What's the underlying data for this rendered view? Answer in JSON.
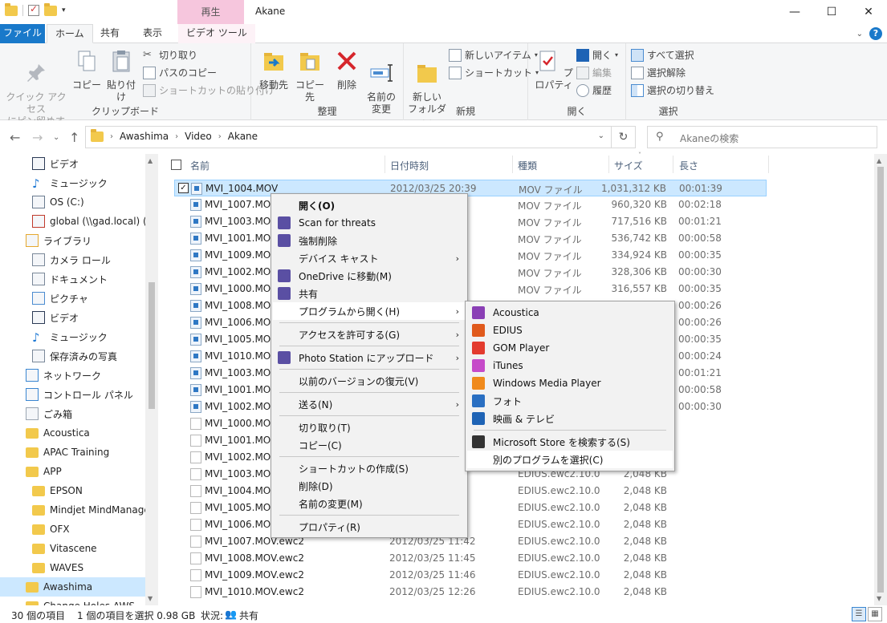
{
  "window": {
    "title": "Akane",
    "context_tab_group": "再生",
    "controls": {
      "minimize": "—",
      "maximize": "☐",
      "close": "✕"
    }
  },
  "ribbon": {
    "tabs": [
      "ファイル",
      "ホーム",
      "共有",
      "表示",
      "ビデオ ツール"
    ],
    "clipboard": {
      "label": "クリップボード",
      "pin": "クイック アクセス\nにピン留めする",
      "copy": "コピー",
      "paste": "貼り付け",
      "cut": "切り取り",
      "copy_path": "パスのコピー",
      "paste_shortcut": "ショートカットの貼り付け"
    },
    "organize": {
      "label": "整理",
      "move_to": "移動先",
      "copy_to": "コピー先",
      "delete": "削除",
      "rename": "名前の\n変更"
    },
    "new": {
      "label": "新規",
      "new_folder": "新しい\nフォルダー",
      "new_item": "新しいアイテム",
      "shortcut": "ショートカット"
    },
    "open": {
      "label": "開く",
      "properties": "プロパティ",
      "open": "開く",
      "edit": "編集",
      "history": "履歴"
    },
    "select": {
      "label": "選択",
      "select_all": "すべて選択",
      "select_none": "選択解除",
      "invert": "選択の切り替え"
    }
  },
  "address": {
    "path": [
      "Awashima",
      "Video",
      "Akane"
    ],
    "search_placeholder": "Akaneの検索"
  },
  "nav_pane": [
    {
      "label": "ビデオ",
      "indent": 1,
      "icon": "video-icon"
    },
    {
      "label": "ミュージック",
      "indent": 1,
      "icon": "music-icon"
    },
    {
      "label": "OS (C:)",
      "indent": 1,
      "icon": "drive-icon"
    },
    {
      "label": "global (\\\\gad.local) (V:",
      "indent": 1,
      "icon": "network-drive-icon"
    },
    {
      "label": "ライブラリ",
      "indent": 0,
      "icon": "library-icon"
    },
    {
      "label": "カメラ ロール",
      "indent": 1,
      "icon": "camera-roll-icon"
    },
    {
      "label": "ドキュメント",
      "indent": 1,
      "icon": "documents-icon"
    },
    {
      "label": "ピクチャ",
      "indent": 1,
      "icon": "pictures-icon"
    },
    {
      "label": "ビデオ",
      "indent": 1,
      "icon": "video-icon"
    },
    {
      "label": "ミュージック",
      "indent": 1,
      "icon": "music-icon"
    },
    {
      "label": "保存済みの写真",
      "indent": 1,
      "icon": "saved-pictures-icon"
    },
    {
      "label": "ネットワーク",
      "indent": 0,
      "icon": "network-icon"
    },
    {
      "label": "コントロール パネル",
      "indent": 0,
      "icon": "control-panel-icon"
    },
    {
      "label": "ごみ箱",
      "indent": 0,
      "icon": "recycle-bin-icon"
    },
    {
      "label": "Acoustica",
      "indent": 0,
      "icon": "folder-icon"
    },
    {
      "label": "APAC Training",
      "indent": 0,
      "icon": "folder-icon"
    },
    {
      "label": "APP",
      "indent": 0,
      "icon": "folder-icon"
    },
    {
      "label": "EPSON",
      "indent": 1,
      "icon": "folder-icon"
    },
    {
      "label": "Mindjet MindManager",
      "indent": 1,
      "icon": "folder-icon"
    },
    {
      "label": "OFX",
      "indent": 1,
      "icon": "folder-icon"
    },
    {
      "label": "Vitascene",
      "indent": 1,
      "icon": "folder-icon"
    },
    {
      "label": "WAVES",
      "indent": 1,
      "icon": "folder-icon"
    },
    {
      "label": "Awashima",
      "indent": 0,
      "icon": "folder-icon",
      "selected": true
    },
    {
      "label": "Change Holes   AWS",
      "indent": 0,
      "icon": "folder-icon"
    }
  ],
  "columns": [
    "名前",
    "日付時刻",
    "種類",
    "サイズ",
    "長さ"
  ],
  "files": [
    {
      "name": "MVI_1004.MOV",
      "date": "2012/03/25 20:39",
      "type": "MOV ファイル",
      "size": "1,031,312 KB",
      "length": "00:01:39",
      "selected": true,
      "kind": "vid"
    },
    {
      "name": "MVI_1007.MOV",
      "date": "",
      "type": "MOV ファイル",
      "size": "960,320 KB",
      "length": "00:02:18",
      "kind": "vid"
    },
    {
      "name": "MVI_1003.MOV",
      "date": "",
      "type": "MOV ファイル",
      "size": "717,516 KB",
      "length": "00:01:21",
      "kind": "vid"
    },
    {
      "name": "MVI_1001.MOV",
      "date": "",
      "type": "MOV ファイル",
      "size": "536,742 KB",
      "length": "00:00:58",
      "kind": "vid"
    },
    {
      "name": "MVI_1009.MOV",
      "date": "",
      "type": "MOV ファイル",
      "size": "334,924 KB",
      "length": "00:00:35",
      "kind": "vid"
    },
    {
      "name": "MVI_1002.MOV",
      "date": "",
      "type": "MOV ファイル",
      "size": "328,306 KB",
      "length": "00:00:30",
      "kind": "vid"
    },
    {
      "name": "MVI_1000.MOV",
      "date": "",
      "type": "MOV ファイル",
      "size": "316,557 KB",
      "length": "00:00:35",
      "kind": "vid"
    },
    {
      "name": "MVI_1008.MOV",
      "date": "",
      "type": "",
      "size": "",
      "length": "00:00:26",
      "kind": "vid"
    },
    {
      "name": "MVI_1006.MOV",
      "date": "",
      "type": "",
      "size": "",
      "length": "00:00:26",
      "kind": "vid"
    },
    {
      "name": "MVI_1005.MOV",
      "date": "",
      "type": "",
      "size": "",
      "length": "00:00:35",
      "kind": "vid"
    },
    {
      "name": "MVI_1010.MOV",
      "date": "",
      "type": "",
      "size": "",
      "length": "00:00:24",
      "kind": "vid"
    },
    {
      "name": "MVI_1003.MOV",
      "date": "",
      "type": "",
      "size": "",
      "length": "00:01:21",
      "kind": "vid"
    },
    {
      "name": "MVI_1001.MOV",
      "date": "",
      "type": "",
      "size": "",
      "length": "00:00:58",
      "kind": "vid"
    },
    {
      "name": "MVI_1002.MOV",
      "date": "",
      "type": "",
      "size": "",
      "length": "00:00:30",
      "kind": "vid"
    },
    {
      "name": "MVI_1000.MOV",
      "date": "",
      "type": "",
      "size": "",
      "length": "",
      "kind": "blank"
    },
    {
      "name": "MVI_1001.MOV",
      "date": "",
      "type": "",
      "size": "",
      "length": "",
      "kind": "blank"
    },
    {
      "name": "MVI_1002.MOV",
      "date": "",
      "type": "",
      "size": "",
      "length": "",
      "kind": "blank"
    },
    {
      "name": "MVI_1003.MOV",
      "date": "",
      "type": "EDIUS.ewc2.10.0",
      "size": "2,048 KB",
      "length": "",
      "kind": "blank"
    },
    {
      "name": "MVI_1004.MOV",
      "date": "",
      "type": "EDIUS.ewc2.10.0",
      "size": "2,048 KB",
      "length": "",
      "kind": "blank"
    },
    {
      "name": "MVI_1005.MOV",
      "date": "",
      "type": "EDIUS.ewc2.10.0",
      "size": "2,048 KB",
      "length": "",
      "kind": "blank"
    },
    {
      "name": "MVI_1006.MOV",
      "date": "",
      "type": "EDIUS.ewc2.10.0",
      "size": "2,048 KB",
      "length": "",
      "kind": "blank"
    },
    {
      "name": "MVI_1007.MOV.ewc2",
      "date": "2012/03/25 11:42",
      "type": "EDIUS.ewc2.10.0",
      "size": "2,048 KB",
      "length": "",
      "kind": "blank"
    },
    {
      "name": "MVI_1008.MOV.ewc2",
      "date": "2012/03/25 11:45",
      "type": "EDIUS.ewc2.10.0",
      "size": "2,048 KB",
      "length": "",
      "kind": "blank"
    },
    {
      "name": "MVI_1009.MOV.ewc2",
      "date": "2012/03/25 11:46",
      "type": "EDIUS.ewc2.10.0",
      "size": "2,048 KB",
      "length": "",
      "kind": "blank"
    },
    {
      "name": "MVI_1010.MOV.ewc2",
      "date": "2012/03/25 12:26",
      "type": "EDIUS.ewc2.10.0",
      "size": "2,048 KB",
      "length": "",
      "kind": "blank"
    }
  ],
  "context_menu": [
    {
      "label": "開く(O)",
      "bold": true
    },
    {
      "label": "Scan for threats",
      "icon": "shield-scan-icon"
    },
    {
      "label": "強制削除",
      "icon": "force-delete-icon"
    },
    {
      "label": "デバイス キャスト",
      "submenu": true
    },
    {
      "label": "OneDrive に移動(M)",
      "icon": "onedrive-icon"
    },
    {
      "label": "共有",
      "icon": "share-icon"
    },
    {
      "label": "プログラムから開く(H)",
      "submenu": true,
      "highlight": true
    },
    {
      "sep": true
    },
    {
      "label": "アクセスを許可する(G)",
      "submenu": true
    },
    {
      "sep": true
    },
    {
      "label": "Photo Station にアップロード",
      "submenu": true,
      "icon": "photo-station-icon"
    },
    {
      "sep": true
    },
    {
      "label": "以前のバージョンの復元(V)"
    },
    {
      "sep": true
    },
    {
      "label": "送る(N)",
      "submenu": true
    },
    {
      "sep": true
    },
    {
      "label": "切り取り(T)"
    },
    {
      "label": "コピー(C)"
    },
    {
      "sep": true
    },
    {
      "label": "ショートカットの作成(S)"
    },
    {
      "label": "削除(D)"
    },
    {
      "label": "名前の変更(M)"
    },
    {
      "sep": true
    },
    {
      "label": "プロパティ(R)"
    }
  ],
  "open_with_menu": [
    {
      "label": "Acoustica",
      "icon": "acoustica-icon",
      "color": "#8a3fb5"
    },
    {
      "label": "EDIUS",
      "icon": "edius-icon",
      "color": "#e05a1c"
    },
    {
      "label": "GOM Player",
      "icon": "gom-player-icon",
      "color": "#e33b2e"
    },
    {
      "label": "iTunes",
      "icon": "itunes-icon",
      "color": "#c64ac9"
    },
    {
      "label": "Windows Media Player",
      "icon": "wmp-icon",
      "color": "#f08a1c"
    },
    {
      "label": "フォト",
      "icon": "photos-icon",
      "color": "#2a6fc2"
    },
    {
      "label": "映画 & テレビ",
      "icon": "movies-tv-icon",
      "color": "#1e63b5"
    },
    {
      "sep": true
    },
    {
      "label": "Microsoft Store を検索する(S)",
      "icon": "store-icon",
      "color": "#333333"
    },
    {
      "label": "別のプログラムを選択(C)",
      "highlight": true
    }
  ],
  "status": {
    "item_count": "30 個の項目",
    "selected": "1 個の項目を選択  0.98 GB",
    "state_label": "状況:",
    "state_value": "共有"
  }
}
